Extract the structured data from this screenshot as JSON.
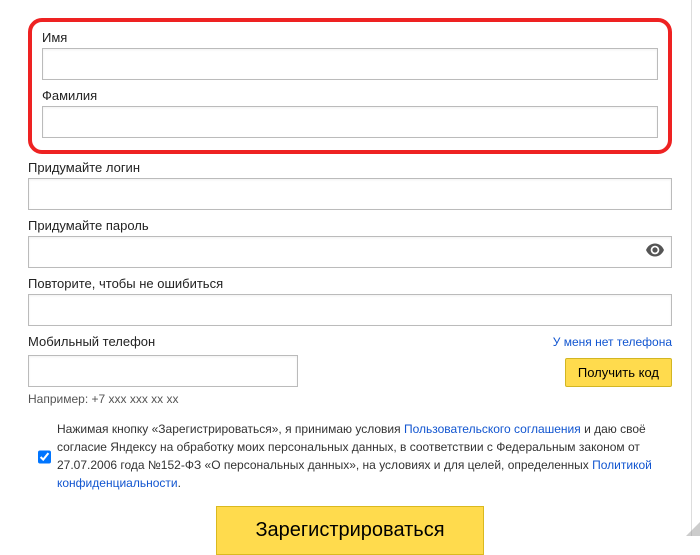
{
  "fields": {
    "firstname_label": "Имя",
    "lastname_label": "Фамилия",
    "login_label": "Придумайте логин",
    "password_label": "Придумайте пароль",
    "password_confirm_label": "Повторите, чтобы не ошибиться",
    "phone_label": "Мобильный телефон",
    "no_phone_link": "У меня нет телефона",
    "phone_example": "Например: +7 xxx xxx xx xx"
  },
  "buttons": {
    "get_code": "Получить код",
    "submit": "Зарегистрироваться"
  },
  "terms": {
    "prefix": "Нажимая кнопку «Зарегистрироваться», я принимаю условия ",
    "agreement_link": "Пользовательского соглашения",
    "mid": " и даю своё согласие Яндексу на обработку моих персональных данных, в соответствии с Федеральным законом от 27.07.2006 года №152-ФЗ «О персональных данных», на условиях и для целей, определенных ",
    "privacy_link": "Политикой конфиденциальности",
    "suffix": "."
  }
}
